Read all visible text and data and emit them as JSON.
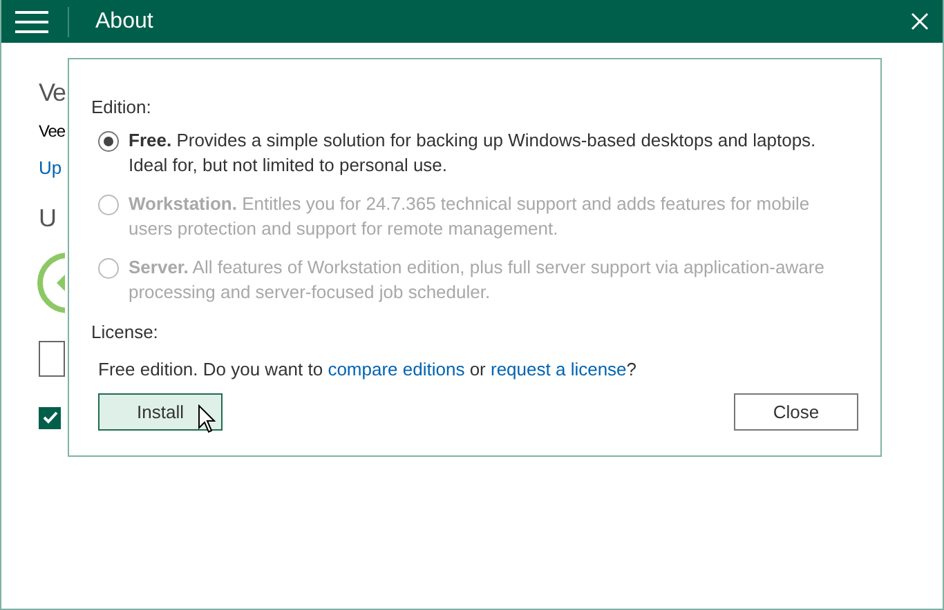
{
  "window": {
    "title": "About"
  },
  "background": {
    "heading": "Ve",
    "line": "Vee",
    "link": "Up",
    "heading_2": "U",
    "checkbox": {
      "checked": true
    }
  },
  "dialog": {
    "edition_label": "Edition:",
    "editions": [
      {
        "text": "**Free.** Provides a simple solution for backing up Windows-based desktops and laptops. Ideal for, but not limited to personal use.",
        "selected": true,
        "disabled": false
      },
      {
        "text": "**Workstation.** Entitles you for 24.7.365 technical support and adds features for mobile users protection and support for remote management.",
        "selected": false,
        "disabled": true
      },
      {
        "text": "**Server.** All features of Workstation edition, plus full server support via application-aware processing and server-focused job scheduler.",
        "selected": false,
        "disabled": true
      }
    ],
    "license_label": "License:",
    "license_sentence": [
      {
        "kind": "text",
        "text": "Free edition. Do you want to "
      },
      {
        "kind": "link",
        "text": "compare editions"
      },
      {
        "kind": "text",
        "text": " or "
      },
      {
        "kind": "link",
        "text": "request a license"
      },
      {
        "kind": "text",
        "text": "?"
      }
    ],
    "buttons": [
      {
        "label": "Install",
        "kind": "primary"
      },
      {
        "label": "Close",
        "kind": "secondary"
      }
    ]
  }
}
